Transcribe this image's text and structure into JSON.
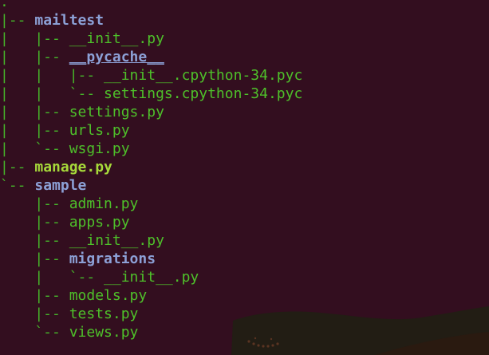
{
  "terminal": {
    "background": "#330e1f",
    "colors": {
      "tree_lines": "#46b52a",
      "file": "#4ec02a",
      "directory": "#8ca0d6",
      "executable": "#a6d93a"
    },
    "tree": [
      {
        "prefix": ".",
        "name": "",
        "kind": "root"
      },
      {
        "prefix": "|-- ",
        "name": "mailtest",
        "kind": "dir"
      },
      {
        "prefix": "|   |-- ",
        "name": "__init__.py",
        "kind": "file"
      },
      {
        "prefix": "|   |-- ",
        "name": "__pycache__",
        "kind": "dir-pkg"
      },
      {
        "prefix": "|   |   |-- ",
        "name": "__init__.cpython-34.pyc",
        "kind": "file"
      },
      {
        "prefix": "|   |   `-- ",
        "name": "settings.cpython-34.pyc",
        "kind": "file"
      },
      {
        "prefix": "|   |-- ",
        "name": "settings.py",
        "kind": "file"
      },
      {
        "prefix": "|   |-- ",
        "name": "urls.py",
        "kind": "file"
      },
      {
        "prefix": "|   `-- ",
        "name": "wsgi.py",
        "kind": "file"
      },
      {
        "prefix": "|-- ",
        "name": "manage.py",
        "kind": "exec"
      },
      {
        "prefix": "`-- ",
        "name": "sample",
        "kind": "dir"
      },
      {
        "prefix": "    |-- ",
        "name": "admin.py",
        "kind": "file"
      },
      {
        "prefix": "    |-- ",
        "name": "apps.py",
        "kind": "file"
      },
      {
        "prefix": "    |-- ",
        "name": "__init__.py",
        "kind": "file"
      },
      {
        "prefix": "    |-- ",
        "name": "migrations",
        "kind": "dir"
      },
      {
        "prefix": "    |   `-- ",
        "name": "__init__.py",
        "kind": "file"
      },
      {
        "prefix": "    |-- ",
        "name": "models.py",
        "kind": "file"
      },
      {
        "prefix": "    |-- ",
        "name": "tests.py",
        "kind": "file"
      },
      {
        "prefix": "    `-- ",
        "name": "views.py",
        "kind": "file"
      }
    ]
  }
}
